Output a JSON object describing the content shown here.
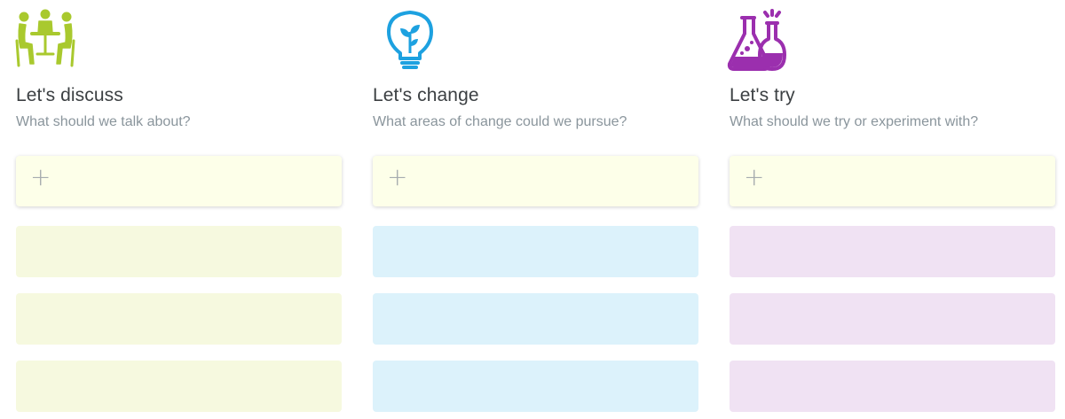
{
  "columns": [
    {
      "title": "Let's discuss",
      "subtitle": "What should we talk about?",
      "icon": "meeting-people-icon",
      "icon_color": "#a9c92e",
      "card_color": "#f6f9df",
      "add_label": "+"
    },
    {
      "title": "Let's change",
      "subtitle": "What areas of change could we pursue?",
      "icon": "lightbulb-plant-icon",
      "icon_color": "#1da1e0",
      "card_color": "#dcf2fb",
      "add_label": "+"
    },
    {
      "title": "Let's try",
      "subtitle": "What should we try or experiment with?",
      "icon": "lab-flasks-icon",
      "icon_color": "#9b2fae",
      "card_color": "#f0e2f3",
      "add_label": "+"
    }
  ]
}
